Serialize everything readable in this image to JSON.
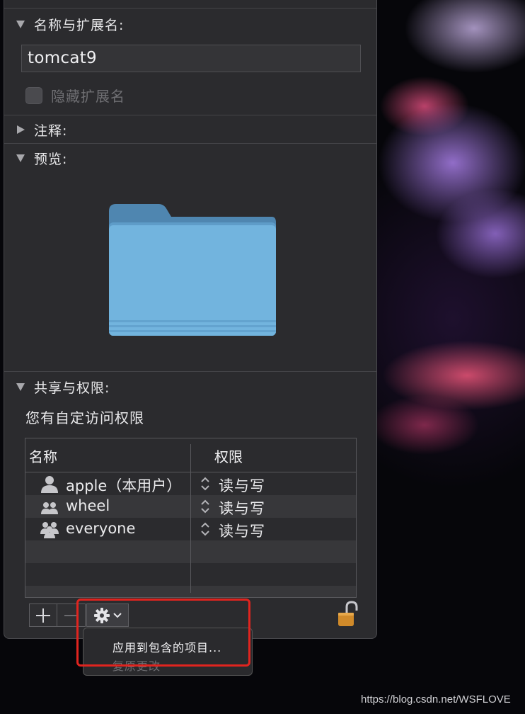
{
  "sections": {
    "name_ext": "名称与扩展名:",
    "comments": "注释:",
    "preview": "预览:",
    "sharing": "共享与权限:"
  },
  "name_field": {
    "value": "tomcat9"
  },
  "hide_extension": {
    "label": "隐藏扩展名",
    "checked": false
  },
  "preview": {
    "icon": "folder-icon",
    "color": "#6fb3df"
  },
  "access_text": "您有自定访问权限",
  "permissions": {
    "headers": {
      "name": "名称",
      "privilege": "权限"
    },
    "rows": [
      {
        "name": "apple（本用户）",
        "privilege": "读与写",
        "icon": "single-user-icon"
      },
      {
        "name": "wheel",
        "privilege": "读与写",
        "icon": "group-icon"
      },
      {
        "name": "everyone",
        "privilege": "读与写",
        "icon": "everyone-icon"
      }
    ]
  },
  "toolbar": {
    "add": "add-icon",
    "remove": "remove-icon",
    "action": "gear-icon"
  },
  "context_menu": {
    "items": [
      {
        "label": "应用到包含的项目...",
        "enabled": true
      },
      {
        "label": "复原更改",
        "enabled": false
      }
    ]
  },
  "colors": {
    "highlight": "#e0241f",
    "panel": "#2b2b2e"
  },
  "watermark": "https://blog.csdn.net/WSFLOVE"
}
